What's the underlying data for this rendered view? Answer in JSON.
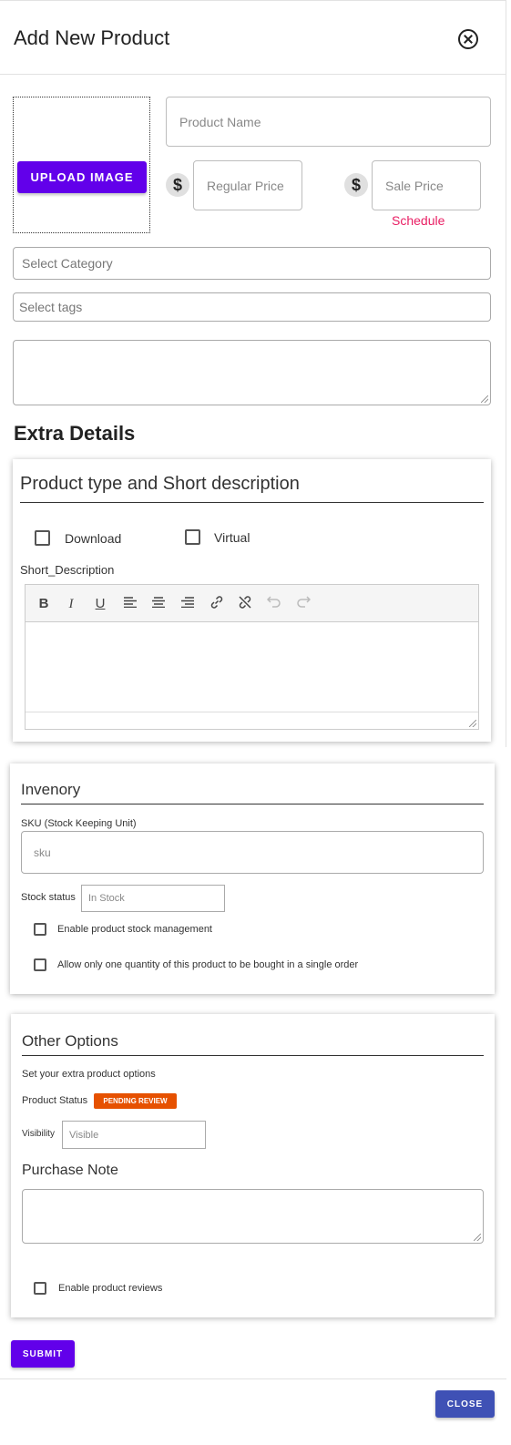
{
  "dialog": {
    "title": "Add New Product",
    "close_icon": "close-circle-icon"
  },
  "product": {
    "upload_label": "UPLOAD IMAGE",
    "name_placeholder": "Product Name",
    "currency_symbol": "$",
    "regular_price_placeholder": "Regular Price",
    "sale_price_placeholder": "Sale Price",
    "schedule_label": "Schedule",
    "category_placeholder": "Select Category",
    "tags_placeholder": "Select tags"
  },
  "extra": {
    "heading": "Extra Details",
    "card_title": "Product type and Short description",
    "download_label": "Download",
    "virtual_label": "Virtual",
    "short_desc_label": "Short_Description",
    "toolbar": [
      "B",
      "I",
      "U",
      "align-left-icon",
      "align-center-icon",
      "align-right-icon",
      "link-icon",
      "unlink-icon",
      "undo-icon",
      "redo-icon"
    ]
  },
  "inventory": {
    "title": "Invenory",
    "sku_label": "SKU (Stock Keeping Unit)",
    "sku_placeholder": "sku",
    "stock_status_label": "Stock status",
    "stock_status_value": "In Stock",
    "manage_stock_label": "Enable product stock management",
    "single_order_label": "Allow only one quantity of this product to be bought in a single order"
  },
  "other": {
    "title": "Other Options",
    "subtitle": "Set your extra product options",
    "status_label": "Product Status",
    "status_badge": "PENDING REVIEW",
    "visibility_label": "Visibility",
    "visibility_value": "Visible",
    "purchase_note_label": "Purchase Note",
    "reviews_label": "Enable product reviews"
  },
  "actions": {
    "submit": "SUBMIT",
    "close": "CLOSE"
  },
  "colors": {
    "primary": "#6200ea",
    "close_button": "#3f51b5",
    "schedule": "#e91e63",
    "badge": "#e65100"
  }
}
